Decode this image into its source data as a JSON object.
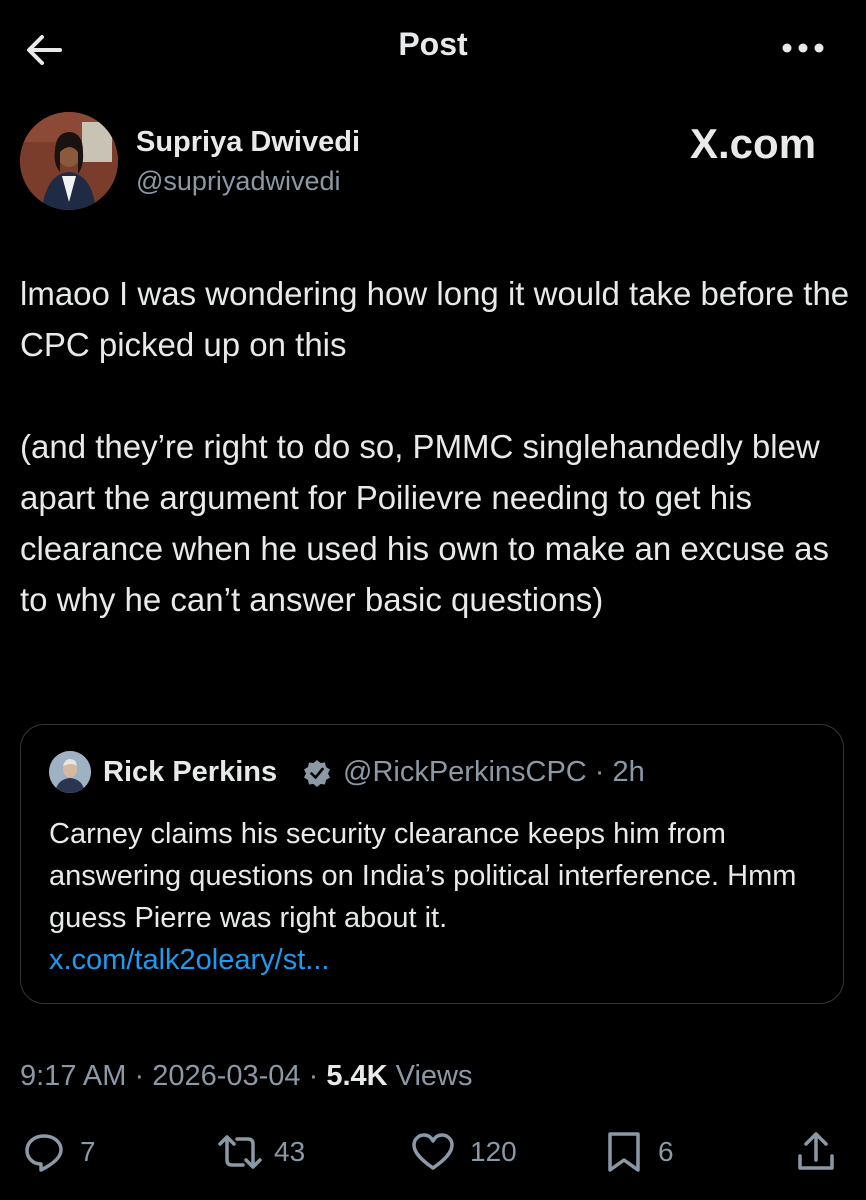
{
  "header": {
    "title": "Post"
  },
  "author": {
    "name": "Supriya Dwivedi",
    "handle": "@supriyadwivedi"
  },
  "watermark": "X.com",
  "post": {
    "text": "lmaoo I was wondering how long it would take before the CPC picked up on this\n\n(and they’re right to do so, PMMC singlehandedly blew apart the argument for Poilievre needing to get his clearance when he used his own to make an excuse as to why he can’t answer basic questions)"
  },
  "quote": {
    "name": "Rick Perkins",
    "handle_time": "@RickPerkinsCPC · 2h",
    "text": "Carney claims his security clearance keeps him from answering questions on India’s political interference. Hmm guess Pierre was right about it.",
    "link": "x.com/talk2oleary/st..."
  },
  "meta": {
    "time": "9:17 AM",
    "date": "2026-03-04",
    "views_count": "5.4K",
    "views_label": "Views"
  },
  "actions": {
    "replies": "7",
    "reposts": "43",
    "likes": "120",
    "bookmarks": "6"
  },
  "colors": {
    "background": "#000000",
    "text": "#e7e9ea",
    "secondary": "#8b98a5",
    "link": "#1d9bf0",
    "verified": "#8b98a5"
  },
  "icons": [
    "back-arrow-icon",
    "more-icon",
    "verified-badge-icon",
    "reply-icon",
    "repost-icon",
    "like-icon",
    "bookmark-icon",
    "share-icon"
  ]
}
